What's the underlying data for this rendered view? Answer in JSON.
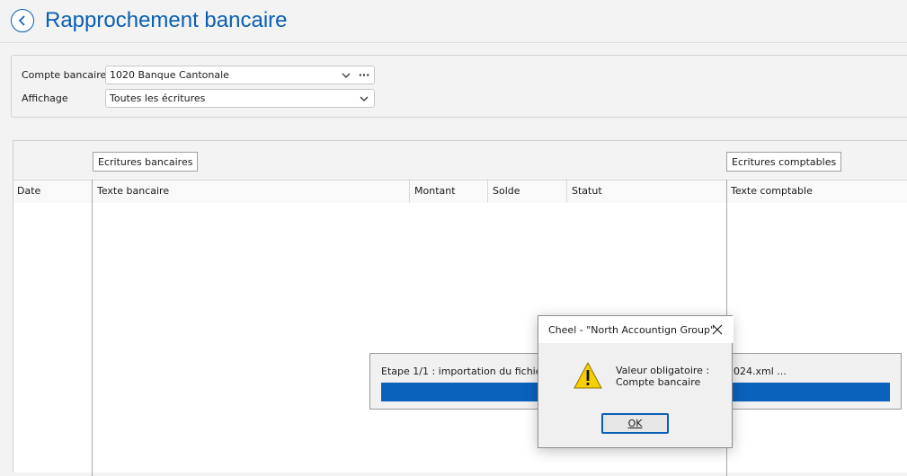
{
  "header": {
    "title": "Rapprochement bancaire"
  },
  "filters": {
    "compte_label": "Compte bancaire",
    "compte_value": "1020 Banque Cantonale",
    "compte_more": "···",
    "affichage_label": "Affichage",
    "affichage_value": "Toutes les écritures"
  },
  "grid": {
    "bank_section": "Ecritures bancaires",
    "accounting_section": "Ecritures comptables",
    "columns": [
      "Date",
      "Texte bancaire",
      "Montant",
      "Solde",
      "Statut",
      "Texte comptable"
    ]
  },
  "progress": {
    "text_start": "Etape 1/1 : importation du fichier BC",
    "text_end": "024.xml ...",
    "fraction": 1.0
  },
  "dialog": {
    "title": "Cheel - \"North Accountign Group\"",
    "message_line1": "Valeur obligatoire :",
    "message_line2": "Compte bancaire",
    "ok_label": "OK"
  },
  "colors": {
    "accent": "#0a5fb4",
    "progress": "#0a62bd",
    "warning": "#f6d000"
  }
}
